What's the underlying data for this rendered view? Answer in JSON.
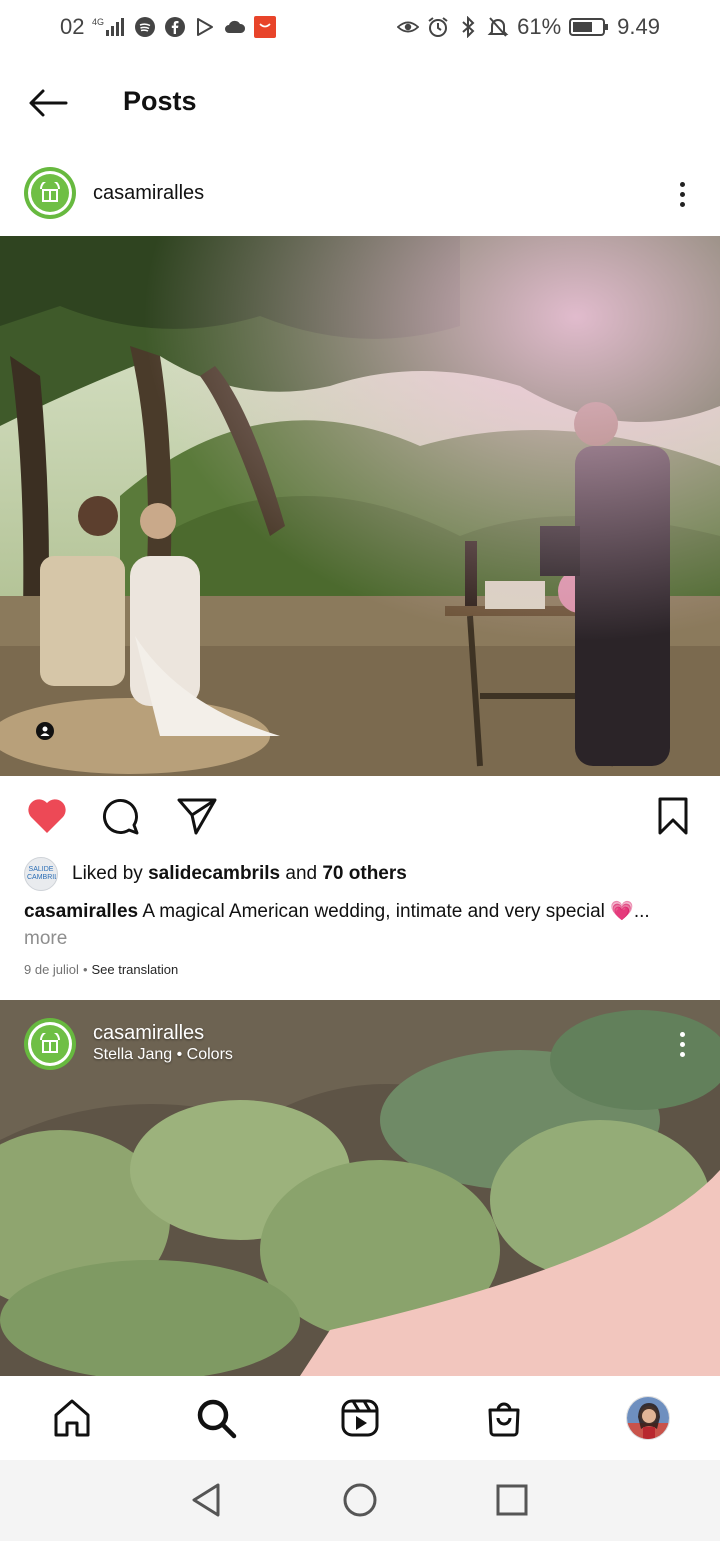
{
  "status_bar": {
    "carrier_text": "02",
    "network": "4G",
    "app_icons": [
      "spotify-icon",
      "facebook-icon",
      "play-store-icon",
      "cloud-icon",
      "mi-store-icon"
    ],
    "right_icons": [
      "eye-icon",
      "alarm-icon",
      "bluetooth-icon",
      "bell-off-icon"
    ],
    "battery_percent": "61%",
    "time": "9.49"
  },
  "header": {
    "title": "Posts"
  },
  "post": {
    "username": "casamiralles",
    "likes": {
      "liked_by_prefix": "Liked by",
      "liked_by_user": "salidecambrils",
      "and_text": "and",
      "others": "70 others",
      "liker_avatar_text": "SALIDE CAMBRILS"
    },
    "caption": {
      "username": "casamiralles",
      "text": "A magical American wedding, intimate and very special 💗...",
      "more": "more"
    },
    "date": "9 de juliol",
    "separator": "•",
    "see_translation": "See translation",
    "liked": true,
    "colors": {
      "like": "#ed4956",
      "accent_green": "#67b93f"
    }
  },
  "reel": {
    "username": "casamiralles",
    "music": "Stella Jang • Colors"
  },
  "bottom_nav": {
    "items": [
      "home-icon",
      "search-icon",
      "reels-icon",
      "shop-icon",
      "profile-avatar"
    ]
  },
  "system_nav": {
    "items": [
      "back-icon",
      "home-circle-icon",
      "recents-icon"
    ]
  }
}
